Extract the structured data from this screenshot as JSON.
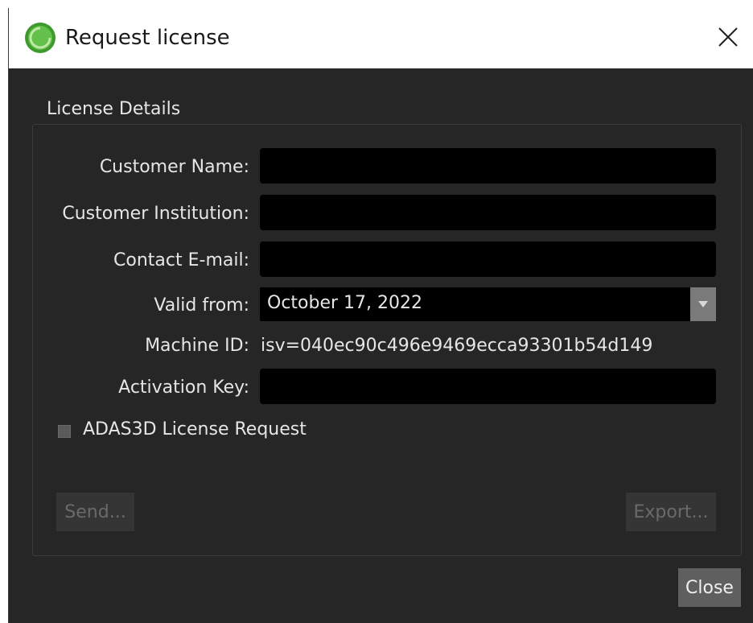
{
  "window": {
    "title": "Request license",
    "icon": "green-circle-app-icon",
    "close_icon": "close-icon"
  },
  "group": {
    "label": "License Details"
  },
  "fields": {
    "customer_name": {
      "label": "Customer Name:",
      "value": ""
    },
    "customer_institution": {
      "label": "Customer Institution:",
      "value": ""
    },
    "contact_email": {
      "label": "Contact E-mail:",
      "value": ""
    },
    "valid_from": {
      "label": "Valid from:",
      "value": "October 17, 2022"
    },
    "machine_id": {
      "label": "Machine ID:",
      "value": "isv=040ec90c496e9469ecca93301b54d149"
    },
    "activation_key": {
      "label": "Activation Key:",
      "value": ""
    }
  },
  "checkbox": {
    "label": "ADAS3D License Request",
    "checked": false
  },
  "buttons": {
    "send": "Send...",
    "export": "Export...",
    "close": "Close"
  },
  "colors": {
    "background": "#262626",
    "field": "#000000",
    "text": "#e6e6e6",
    "accent_icon": "#4caf3a"
  }
}
